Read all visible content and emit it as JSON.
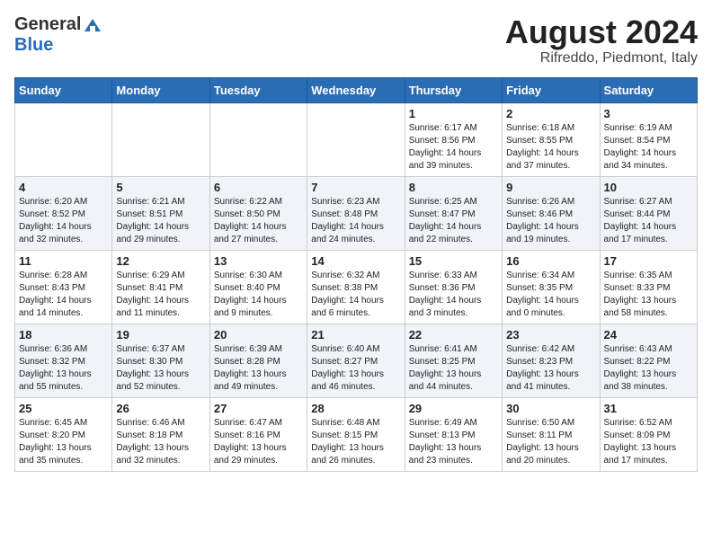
{
  "header": {
    "logo_line1": "General",
    "logo_line2": "Blue",
    "title": "August 2024",
    "subtitle": "Rifreddo, Piedmont, Italy"
  },
  "days_of_week": [
    "Sunday",
    "Monday",
    "Tuesday",
    "Wednesday",
    "Thursday",
    "Friday",
    "Saturday"
  ],
  "weeks": [
    [
      {
        "day": "",
        "info": ""
      },
      {
        "day": "",
        "info": ""
      },
      {
        "day": "",
        "info": ""
      },
      {
        "day": "",
        "info": ""
      },
      {
        "day": "1",
        "info": "Sunrise: 6:17 AM\nSunset: 8:56 PM\nDaylight: 14 hours\nand 39 minutes."
      },
      {
        "day": "2",
        "info": "Sunrise: 6:18 AM\nSunset: 8:55 PM\nDaylight: 14 hours\nand 37 minutes."
      },
      {
        "day": "3",
        "info": "Sunrise: 6:19 AM\nSunset: 8:54 PM\nDaylight: 14 hours\nand 34 minutes."
      }
    ],
    [
      {
        "day": "4",
        "info": "Sunrise: 6:20 AM\nSunset: 8:52 PM\nDaylight: 14 hours\nand 32 minutes."
      },
      {
        "day": "5",
        "info": "Sunrise: 6:21 AM\nSunset: 8:51 PM\nDaylight: 14 hours\nand 29 minutes."
      },
      {
        "day": "6",
        "info": "Sunrise: 6:22 AM\nSunset: 8:50 PM\nDaylight: 14 hours\nand 27 minutes."
      },
      {
        "day": "7",
        "info": "Sunrise: 6:23 AM\nSunset: 8:48 PM\nDaylight: 14 hours\nand 24 minutes."
      },
      {
        "day": "8",
        "info": "Sunrise: 6:25 AM\nSunset: 8:47 PM\nDaylight: 14 hours\nand 22 minutes."
      },
      {
        "day": "9",
        "info": "Sunrise: 6:26 AM\nSunset: 8:46 PM\nDaylight: 14 hours\nand 19 minutes."
      },
      {
        "day": "10",
        "info": "Sunrise: 6:27 AM\nSunset: 8:44 PM\nDaylight: 14 hours\nand 17 minutes."
      }
    ],
    [
      {
        "day": "11",
        "info": "Sunrise: 6:28 AM\nSunset: 8:43 PM\nDaylight: 14 hours\nand 14 minutes."
      },
      {
        "day": "12",
        "info": "Sunrise: 6:29 AM\nSunset: 8:41 PM\nDaylight: 14 hours\nand 11 minutes."
      },
      {
        "day": "13",
        "info": "Sunrise: 6:30 AM\nSunset: 8:40 PM\nDaylight: 14 hours\nand 9 minutes."
      },
      {
        "day": "14",
        "info": "Sunrise: 6:32 AM\nSunset: 8:38 PM\nDaylight: 14 hours\nand 6 minutes."
      },
      {
        "day": "15",
        "info": "Sunrise: 6:33 AM\nSunset: 8:36 PM\nDaylight: 14 hours\nand 3 minutes."
      },
      {
        "day": "16",
        "info": "Sunrise: 6:34 AM\nSunset: 8:35 PM\nDaylight: 14 hours\nand 0 minutes."
      },
      {
        "day": "17",
        "info": "Sunrise: 6:35 AM\nSunset: 8:33 PM\nDaylight: 13 hours\nand 58 minutes."
      }
    ],
    [
      {
        "day": "18",
        "info": "Sunrise: 6:36 AM\nSunset: 8:32 PM\nDaylight: 13 hours\nand 55 minutes."
      },
      {
        "day": "19",
        "info": "Sunrise: 6:37 AM\nSunset: 8:30 PM\nDaylight: 13 hours\nand 52 minutes."
      },
      {
        "day": "20",
        "info": "Sunrise: 6:39 AM\nSunset: 8:28 PM\nDaylight: 13 hours\nand 49 minutes."
      },
      {
        "day": "21",
        "info": "Sunrise: 6:40 AM\nSunset: 8:27 PM\nDaylight: 13 hours\nand 46 minutes."
      },
      {
        "day": "22",
        "info": "Sunrise: 6:41 AM\nSunset: 8:25 PM\nDaylight: 13 hours\nand 44 minutes."
      },
      {
        "day": "23",
        "info": "Sunrise: 6:42 AM\nSunset: 8:23 PM\nDaylight: 13 hours\nand 41 minutes."
      },
      {
        "day": "24",
        "info": "Sunrise: 6:43 AM\nSunset: 8:22 PM\nDaylight: 13 hours\nand 38 minutes."
      }
    ],
    [
      {
        "day": "25",
        "info": "Sunrise: 6:45 AM\nSunset: 8:20 PM\nDaylight: 13 hours\nand 35 minutes."
      },
      {
        "day": "26",
        "info": "Sunrise: 6:46 AM\nSunset: 8:18 PM\nDaylight: 13 hours\nand 32 minutes."
      },
      {
        "day": "27",
        "info": "Sunrise: 6:47 AM\nSunset: 8:16 PM\nDaylight: 13 hours\nand 29 minutes."
      },
      {
        "day": "28",
        "info": "Sunrise: 6:48 AM\nSunset: 8:15 PM\nDaylight: 13 hours\nand 26 minutes."
      },
      {
        "day": "29",
        "info": "Sunrise: 6:49 AM\nSunset: 8:13 PM\nDaylight: 13 hours\nand 23 minutes."
      },
      {
        "day": "30",
        "info": "Sunrise: 6:50 AM\nSunset: 8:11 PM\nDaylight: 13 hours\nand 20 minutes."
      },
      {
        "day": "31",
        "info": "Sunrise: 6:52 AM\nSunset: 8:09 PM\nDaylight: 13 hours\nand 17 minutes."
      }
    ]
  ]
}
